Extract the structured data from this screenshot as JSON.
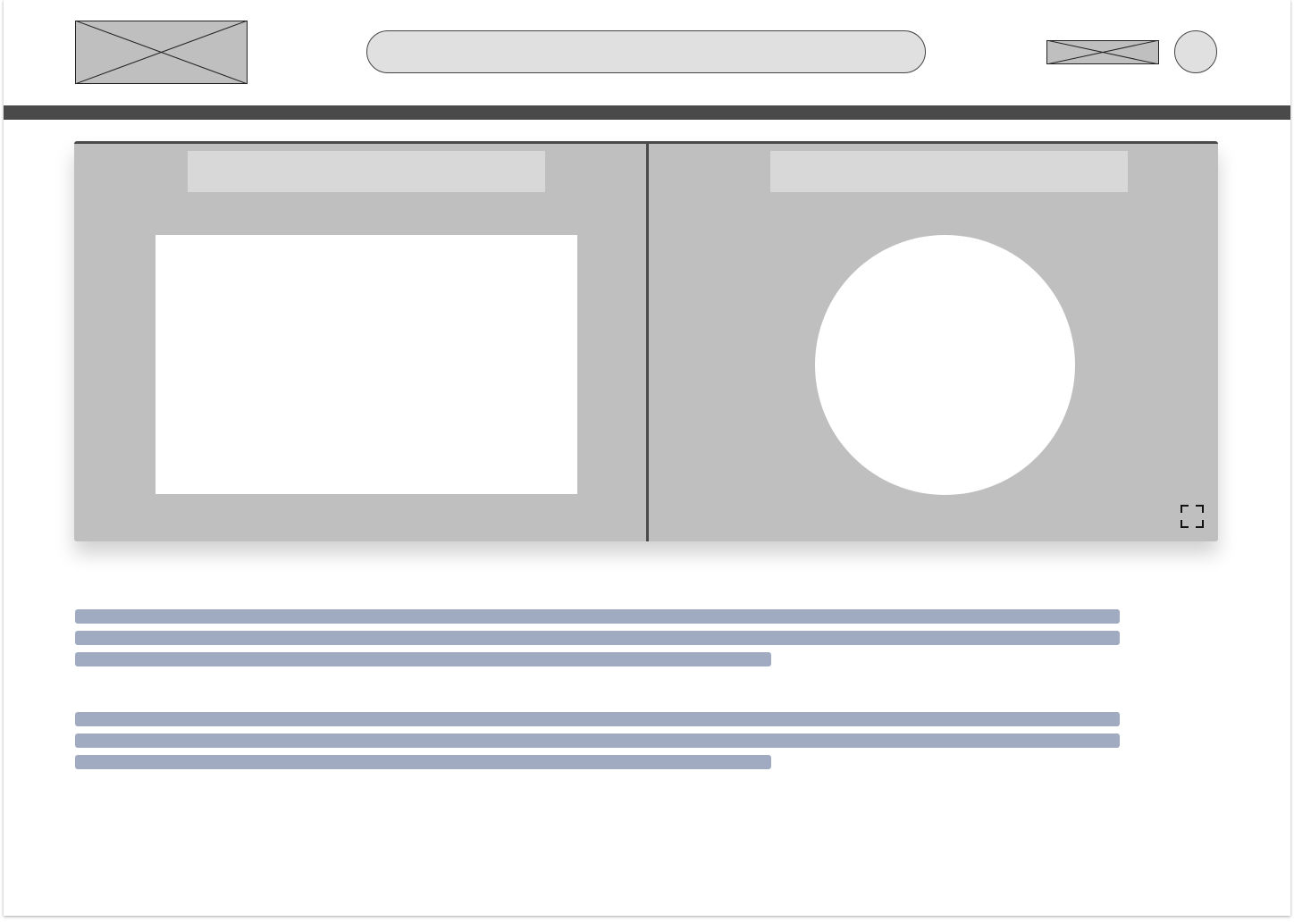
{
  "header": {
    "logo": {
      "icon": "image-placeholder-icon"
    },
    "search": {
      "value": "",
      "placeholder": ""
    },
    "media_placeholder": {
      "icon": "image-placeholder-icon"
    },
    "avatar": {
      "icon": "avatar-icon"
    }
  },
  "carousel": {
    "slides": [
      {
        "title": "",
        "shape": "rectangle"
      },
      {
        "title": "",
        "shape": "circle"
      }
    ],
    "fullscreen": {
      "icon": "fullscreen-icon"
    }
  },
  "content": {
    "paragraphs": [
      {
        "lines": [
          "",
          "",
          ""
        ]
      },
      {
        "lines": [
          "",
          "",
          ""
        ]
      }
    ]
  },
  "colors": {
    "navbar": "#4a4a4a",
    "carousel_bg": "#c0bfc0",
    "placeholder_text": "#a0aac0",
    "search_bg": "#e0e0e0"
  }
}
